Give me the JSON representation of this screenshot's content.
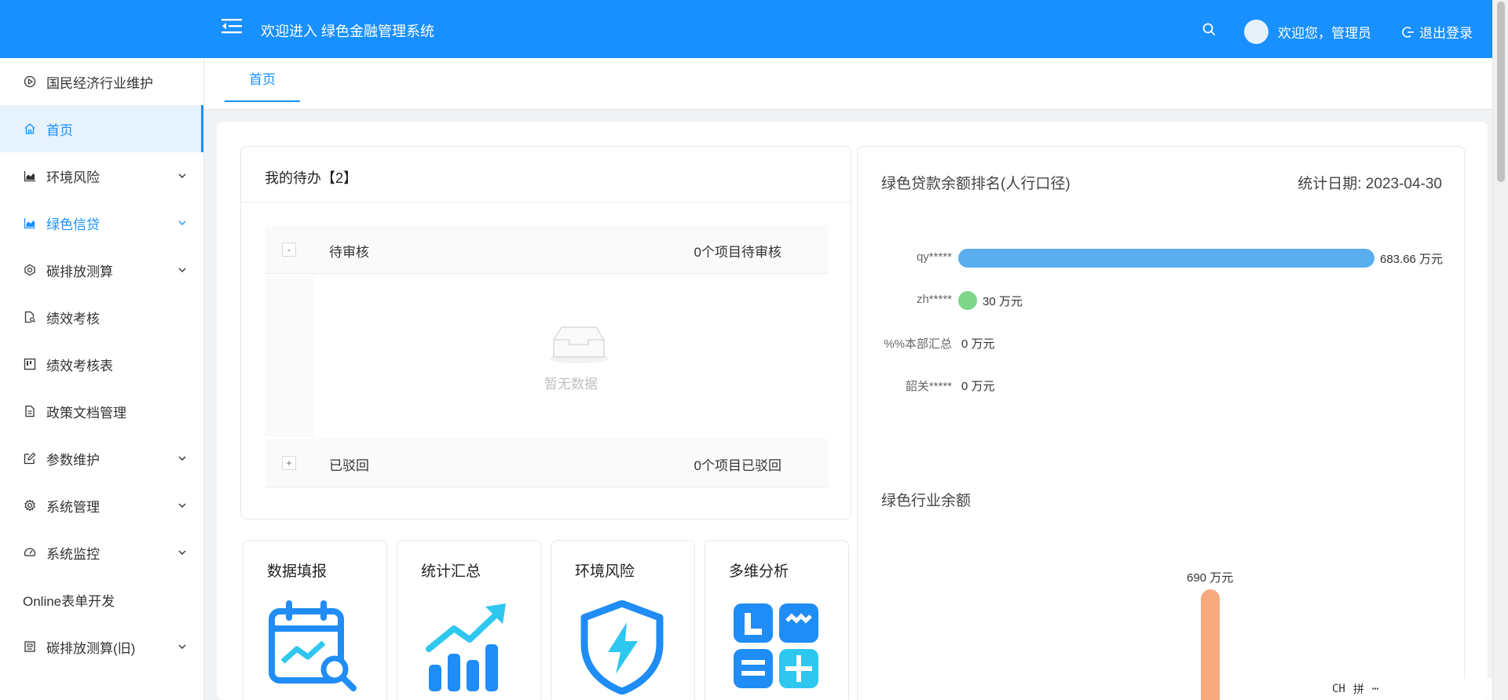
{
  "header": {
    "title": "欢迎进入 绿色金融管理系统",
    "welcome": "欢迎您，管理员",
    "logout": "退出登录",
    "brand_color": "#1890ff"
  },
  "sidebar": {
    "items": [
      {
        "label": "国民经济行业维护",
        "icon": "play-circle-icon"
      },
      {
        "label": "首页",
        "icon": "home-icon"
      },
      {
        "label": "环境风险",
        "icon": "area-chart-icon"
      },
      {
        "label": "绿色信贷",
        "icon": "area-chart-icon"
      },
      {
        "label": "碳排放测算",
        "icon": "hexagon-icon"
      },
      {
        "label": "绩效考核",
        "icon": "file-search-icon"
      },
      {
        "label": "绩效考核表",
        "icon": "kanban-icon"
      },
      {
        "label": "政策文档管理",
        "icon": "file-icon"
      },
      {
        "label": "参数维护",
        "icon": "edit-icon"
      },
      {
        "label": "系统管理",
        "icon": "gear-icon"
      },
      {
        "label": "系统监控",
        "icon": "dashboard-icon"
      },
      {
        "label": "Online表单开发",
        "icon": ""
      },
      {
        "label": "碳排放测算(旧)",
        "icon": "calculator-icon"
      }
    ]
  },
  "tabs": [
    {
      "label": "首页"
    }
  ],
  "todo": {
    "title": "我的待办【2】",
    "groups": [
      {
        "toggle": "-",
        "label": "待审核",
        "count": "0个项目待审核"
      },
      {
        "toggle": "+",
        "label": "已驳回",
        "count": "0个项目已驳回"
      }
    ],
    "empty_text": "暂无数据"
  },
  "quick_cards": [
    {
      "title": "数据填报",
      "icon": "calendar-chart-icon"
    },
    {
      "title": "统计汇总",
      "icon": "trend-up-icon"
    },
    {
      "title": "环境风险",
      "icon": "shield-bolt-icon"
    },
    {
      "title": "多维分析",
      "icon": "grid-analysis-icon"
    }
  ],
  "ranking": {
    "title": "绿色贷款余额排名(人行口径)",
    "date": "统计日期: 2023-04-30"
  },
  "industry": {
    "title": "绿色行业余额"
  },
  "chart_data": [
    {
      "type": "bar",
      "orientation": "horizontal",
      "title": "绿色贷款余额排名(人行口径)",
      "categories": [
        "qy*****",
        "zh*****",
        "%%本部汇总",
        "韶关*****"
      ],
      "values": [
        683.66,
        30,
        0,
        0
      ],
      "value_labels": [
        "683.66 万元",
        "30 万元",
        "0 万元",
        "0 万元"
      ],
      "colors": [
        "#5aaeee",
        "#7dd68a",
        "#5aaeee",
        "#5aaeee"
      ]
    },
    {
      "type": "bar",
      "orientation": "vertical",
      "title": "绿色行业余额",
      "values": [
        690
      ],
      "value_labels": [
        "690 万元"
      ],
      "colors": [
        "#f7aa7e"
      ]
    }
  ],
  "tray": {
    "lang": "CH",
    "ime": "拼"
  }
}
